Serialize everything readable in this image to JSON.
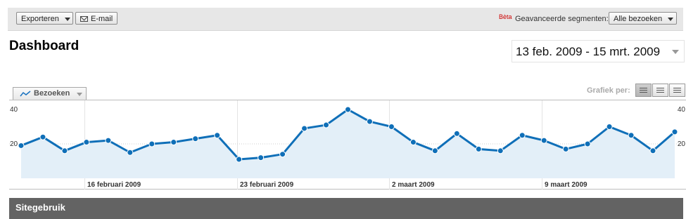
{
  "toolbar": {
    "export_label": "Exporteren",
    "email_label": "E-mail",
    "beta_label": "Bèta",
    "segments_label": "Geavanceerde segmenten:",
    "segments_value": "Alle bezoeken"
  },
  "page_title": "Dashboard",
  "date_range": "13 feb. 2009 - 15 mrt. 2009",
  "metric_tab": "Bezoeken",
  "graph_by_label": "Grafiek per:",
  "section_title": "Sitegebruik",
  "colors": {
    "line": "#0f6fb8",
    "fill": "#e3eff8",
    "accent_beta": "#cc0000"
  },
  "chart_data": {
    "type": "area",
    "x": [
      "13 feb",
      "14 feb",
      "15 feb",
      "16 feb",
      "17 feb",
      "18 feb",
      "19 feb",
      "20 feb",
      "21 feb",
      "22 feb",
      "23 feb",
      "24 feb",
      "25 feb",
      "26 feb",
      "27 feb",
      "28 feb",
      "1 mrt",
      "2 mrt",
      "3 mrt",
      "4 mrt",
      "5 mrt",
      "6 mrt",
      "7 mrt",
      "8 mrt",
      "9 mrt",
      "10 mrt",
      "11 mrt",
      "12 mrt",
      "13 mrt",
      "14 mrt",
      "15 mrt"
    ],
    "values": [
      19,
      24,
      16,
      21,
      22,
      15,
      20,
      21,
      23,
      25,
      11,
      12,
      14,
      29,
      31,
      40,
      33,
      30,
      21,
      16,
      26,
      17,
      16,
      25,
      22,
      17,
      20,
      30,
      25,
      16,
      27
    ],
    "ylim": [
      0,
      40
    ],
    "y_ticks": [
      "20",
      "40"
    ],
    "x_ticks": [
      {
        "index": 3,
        "label": "16 februari 2009"
      },
      {
        "index": 10,
        "label": "23 februari 2009"
      },
      {
        "index": 17,
        "label": "2 maart 2009"
      },
      {
        "index": 24,
        "label": "9 maart 2009"
      }
    ],
    "grid": true
  }
}
